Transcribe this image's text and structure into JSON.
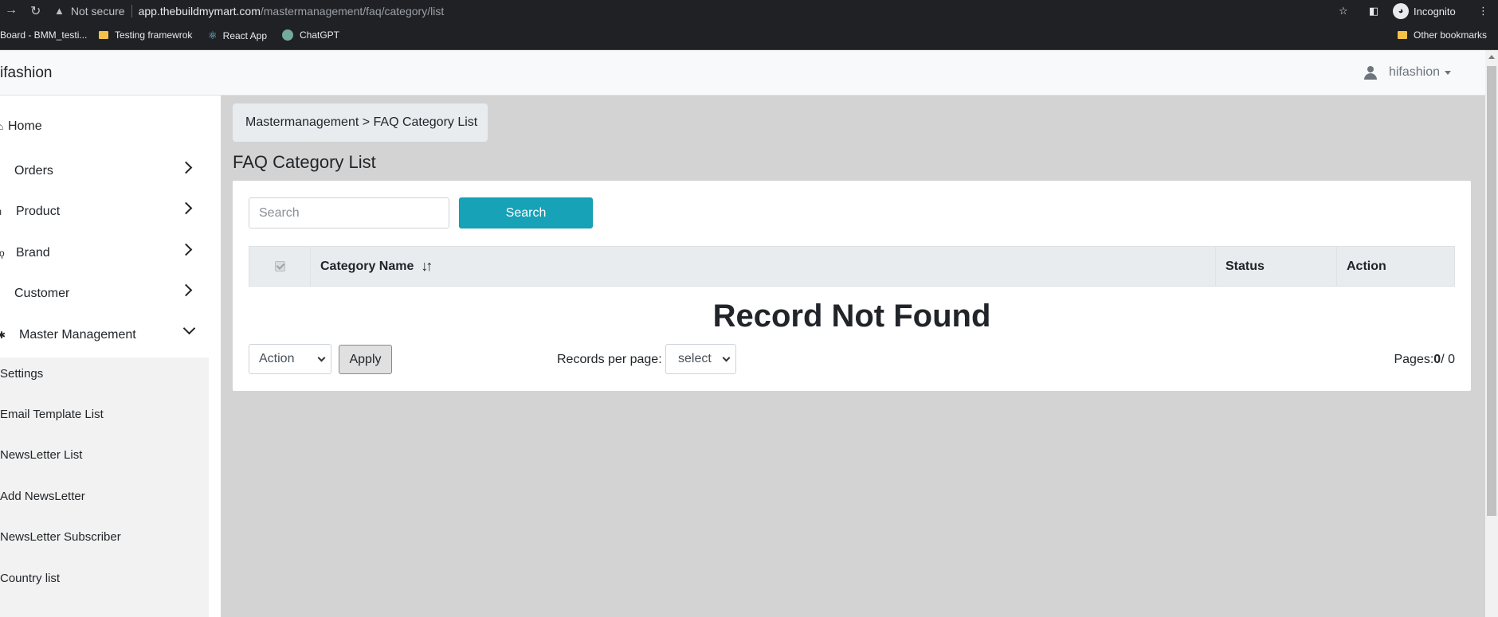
{
  "browser": {
    "security_label": "Not secure",
    "url_host": "app.thebuildmymart.com",
    "url_path": "/mastermanagement/faq/category/list",
    "incognito_label": "Incognito",
    "bookmarks": [
      "Board - BMM_testi...",
      "Testing framewrok",
      "React App",
      "ChatGPT"
    ],
    "other_bookmarks": "Other bookmarks"
  },
  "header": {
    "brand": "ifashion",
    "user": "hifashion"
  },
  "sidebar": {
    "items": [
      {
        "label": "Home",
        "icon": "home-icon"
      },
      {
        "label": "Orders",
        "icon": "orders-icon"
      },
      {
        "label": "Product",
        "icon": "product-icon"
      },
      {
        "label": "Brand",
        "icon": "brand-icon"
      },
      {
        "label": "Customer",
        "icon": "customer-icon"
      },
      {
        "label": "Master Management",
        "icon": "gear-icon"
      }
    ],
    "submenu": [
      "Settings",
      "Email Template List",
      "NewsLetter List",
      "Add NewsLetter",
      "NewsLetter Subscriber",
      "Country list"
    ]
  },
  "main": {
    "breadcrumb": "Mastermanagement > FAQ Category List",
    "title": "FAQ Category List",
    "search_placeholder": "Search",
    "search_button": "Search",
    "table": {
      "columns": [
        "Category Name",
        "Status",
        "Action"
      ]
    },
    "empty_message": "Record Not Found",
    "bulk_action": "Action",
    "apply_button": "Apply",
    "records_per_page_label": "Records per page:",
    "records_per_page_value": "select",
    "pages_label": "Pages:",
    "pages_current": "0",
    "pages_total": "/ 0"
  }
}
